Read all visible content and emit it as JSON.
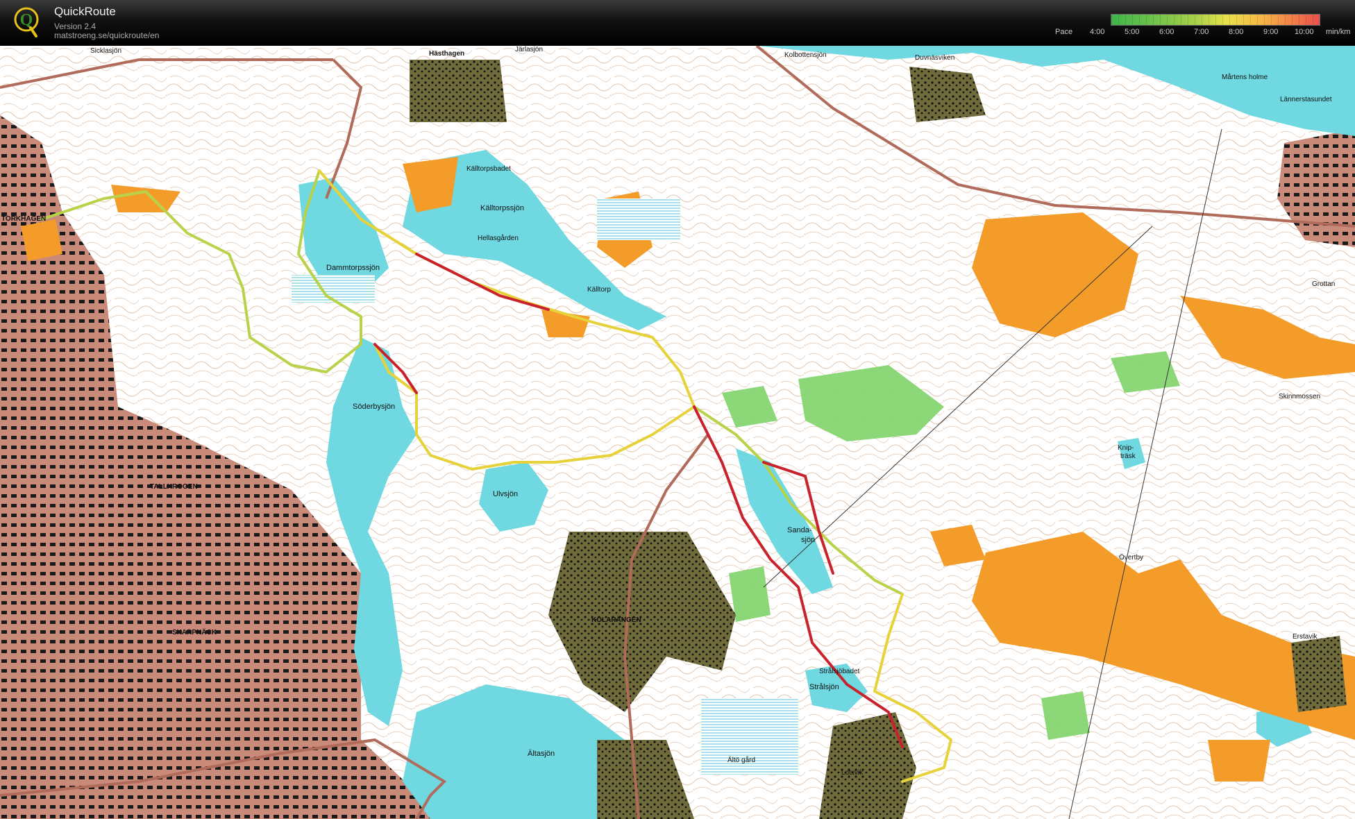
{
  "app": {
    "title": "QuickRoute",
    "version": "Version 2.4",
    "url": "matstroeng.se/quickroute/en",
    "logo_letter": "Q"
  },
  "pace_legend": {
    "label": "Pace",
    "ticks": [
      "4:00",
      "5:00",
      "6:00",
      "7:00",
      "8:00",
      "9:00",
      "10:00"
    ],
    "unit": "min/km",
    "colors": [
      "#3fb54a",
      "#a7d14a",
      "#e7e24a",
      "#f6b846",
      "#f17c49",
      "#e9504c"
    ]
  },
  "map": {
    "colors": {
      "water": "#6fd8e0",
      "forest_white": "#ffffff",
      "green": "#7fd46a",
      "open_land": "#f39c2a",
      "urban": "#c98a7a",
      "dark_forest": "#6f6b3a",
      "route_slow": "#c8232c",
      "route_fast": "#e6d23a"
    },
    "labels": {
      "l1": "Sicklasjön",
      "l2": "Hästhagen",
      "l3": "Järlasjön",
      "l4": "Kolbottensjön",
      "l5": "Duvnäsviken",
      "l6": "Lännerstasundet",
      "l7": "Mårtens holme",
      "l8": "Källtorpsbadet",
      "l9": "Källtorpssjön",
      "l10": "Hellasgården",
      "l11": "Dammtorpssjön",
      "l12": "Källtorp",
      "l13": "Söderbysjön",
      "l14": "Ulvsjön",
      "l15": "Sanda-",
      "l16": "sjön",
      "l17": "Knip-",
      "l18": "träsk",
      "l19": "Skinnmossen",
      "l20": "KOLARÄNGEN",
      "l21": "SKARPNÄCK",
      "l22": "Ältasjön",
      "l23": "Strålsjön",
      "l24": "Strålsjöbadet",
      "l25": "Erstavik",
      "l26": "Grottan",
      "l27": "Övertby",
      "l28": "Ältö gård",
      "l29": "TORKHAGEN",
      "l30": "TALLKROGEN",
      "l31": "Lotsvik"
    }
  }
}
